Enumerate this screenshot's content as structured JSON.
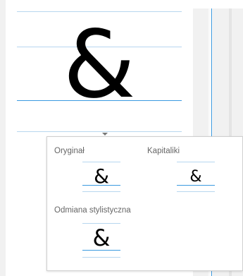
{
  "preview": {
    "glyph": "&",
    "icon": "chevron-down-icon"
  },
  "flyout": {
    "original": {
      "label": "Oryginał",
      "glyph": "&"
    },
    "small_caps": {
      "label": "Kapitaliki",
      "glyph": "&"
    },
    "stylistic": {
      "label": "Odmiana stylistyczna",
      "glyph": "&"
    }
  },
  "colors": {
    "guide_line": "#b7d6ef",
    "baseline": "#3a9ae0",
    "label_text": "#666666",
    "panel_border": "#cfcfcf"
  }
}
